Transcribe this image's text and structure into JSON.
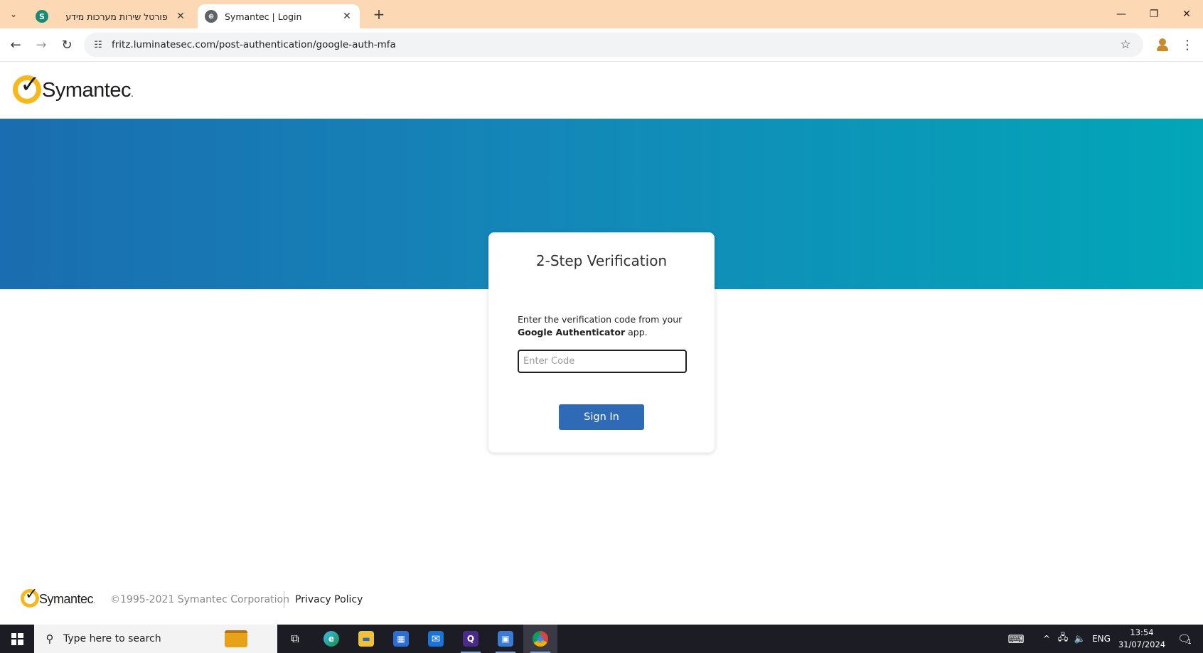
{
  "browser": {
    "tabs": [
      {
        "title": "פורטל שירות מערכות מידע",
        "favicon_letter": "S",
        "active": false
      },
      {
        "title": "Symantec | Login",
        "active": true
      }
    ],
    "close_glyph": "✕",
    "new_tab_glyph": "+",
    "url": "fritz.luminatesec.com/post-authentication/google-auth-mfa",
    "icons": {
      "tab_search": "⌄",
      "back": "←",
      "forward": "→",
      "reload": "↻",
      "site_info": "☷",
      "bookmark": "☆",
      "menu": "⋮",
      "minimize": "—",
      "restore": "❐",
      "close": "✕"
    }
  },
  "header": {
    "logo_text": "Symantec",
    "logo_check": "✓",
    "logo_dot": "."
  },
  "colors": {
    "banner_start": "#1a6db0",
    "banner_end": "#02a6b8",
    "logo_yellow": "#f7b81a",
    "button_blue": "#2f6ab6"
  },
  "card": {
    "title": "2-Step Verification",
    "instruction_prefix": "Enter the verification code from your ",
    "instruction_app": "Google Authenticator",
    "instruction_suffix": " app.",
    "input_value": "",
    "input_placeholder": "Enter Code",
    "button_label": "Sign In"
  },
  "footer": {
    "logo_text": "Symantec",
    "logo_check": "✓",
    "logo_dot": ".",
    "copyright": "©1995-2021 Symantec Corporation",
    "privacy_label": "Privacy Policy"
  },
  "taskbar": {
    "search_placeholder": "Type here to search",
    "search_icon": "⚲",
    "apps": [
      {
        "name": "task-view",
        "glyph": "⧉"
      },
      {
        "name": "edge",
        "glyph": "e"
      },
      {
        "name": "file-explorer",
        "glyph": "▬"
      },
      {
        "name": "store",
        "glyph": "▦"
      },
      {
        "name": "mail",
        "glyph": "✉"
      },
      {
        "name": "app-q",
        "glyph": "Q"
      },
      {
        "name": "remote-desktop",
        "glyph": "▣"
      },
      {
        "name": "chrome",
        "glyph": "◉"
      }
    ],
    "tray": {
      "keyboard": "⌨",
      "chevron": "^",
      "network": "🖧",
      "volume": "🔈",
      "language": "ENG",
      "notifications": "🗨",
      "notification_count": "1"
    },
    "time": "13:54",
    "date": "31/07/2024"
  }
}
